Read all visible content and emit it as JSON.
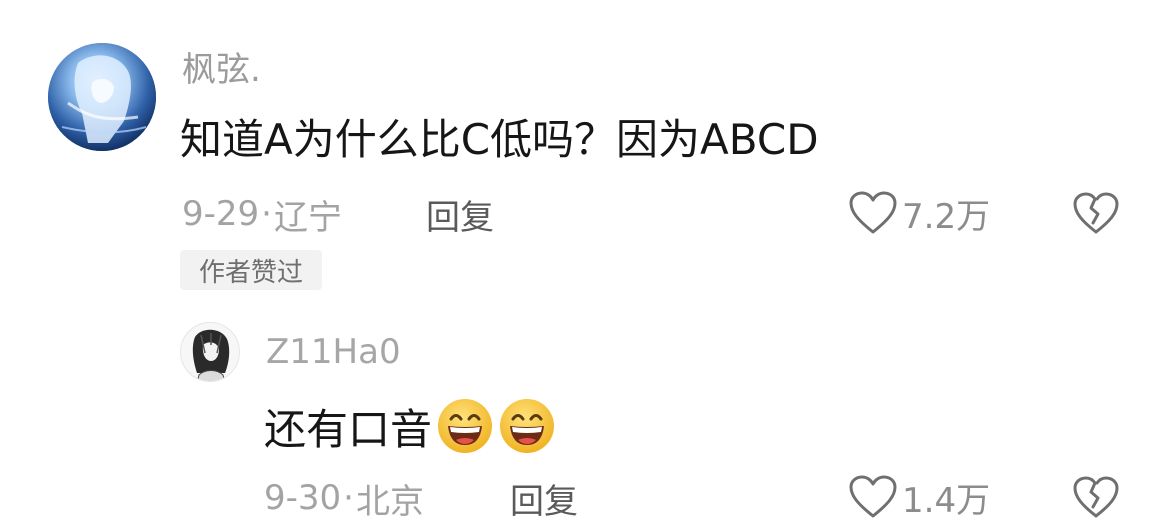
{
  "comments": [
    {
      "username": "枫弦.",
      "text": "知道A为什么比C低吗？因为ABCD",
      "date": "9-29",
      "location": "辽宁",
      "reply_label": "回复",
      "likes": "7.2万",
      "badge": "作者赞过",
      "avatar_icon": "anime-character-avatar",
      "like_icon": "heart-outline-icon",
      "dislike_icon": "broken-heart-icon"
    },
    {
      "username": "Z11Ha0",
      "text": "还有口音",
      "emojis": [
        "grinning-face-emoji",
        "grinning-face-emoji"
      ],
      "date": "9-30",
      "location": "北京",
      "reply_label": "回复",
      "likes": "1.4万",
      "avatar_icon": "sketch-portrait-avatar",
      "like_icon": "heart-outline-icon",
      "dislike_icon": "broken-heart-icon"
    }
  ],
  "meta_separator": "·",
  "colors": {
    "username": "#9b9b9b",
    "meta": "#a3a3a3",
    "body_text": "#161616",
    "badge_bg": "#f2f2f2",
    "emoji_yellow": "#f7c63a"
  }
}
